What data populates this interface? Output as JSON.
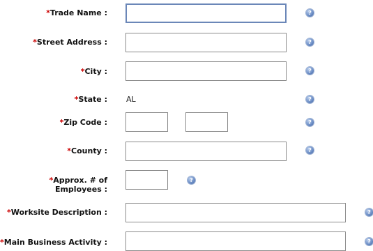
{
  "required_marker": "*",
  "help_glyph": "?",
  "colors": {
    "required": "#cc0000",
    "help_icon": "#5a7fc0",
    "focus_border": "#6b87b8"
  },
  "fields": {
    "trade_name": {
      "label": "Trade Name :",
      "value": ""
    },
    "street_address": {
      "label": "Street Address :",
      "value": ""
    },
    "city": {
      "label": "City :",
      "value": ""
    },
    "state": {
      "label": "State :",
      "value": "AL"
    },
    "zip_code": {
      "label": "Zip Code :",
      "value": "",
      "ext_value": ""
    },
    "county": {
      "label": "County :",
      "value": ""
    },
    "employees": {
      "label_line1": "Approx. # of",
      "label_line2": "Employees :",
      "value": ""
    },
    "worksite_description": {
      "label": "Worksite Description :",
      "value": ""
    },
    "main_business_activity": {
      "label": "Main Business Activity :",
      "value": ""
    }
  }
}
